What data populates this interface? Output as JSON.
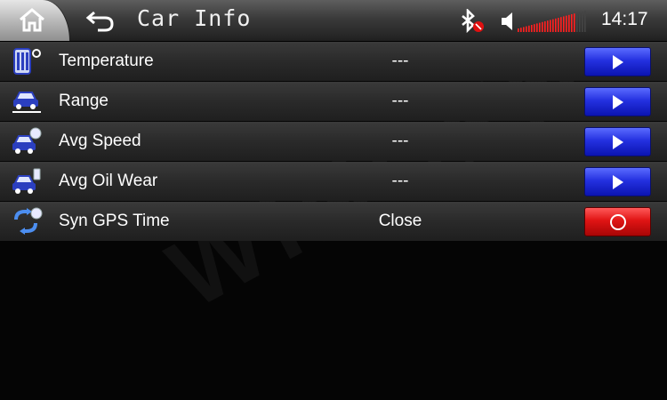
{
  "header": {
    "title": "Car Info",
    "clock": "14:17"
  },
  "icons": {
    "home": "home-icon",
    "back": "back-arrow-icon",
    "bluetooth": "bluetooth-disconnected-icon",
    "volume": "speaker-icon"
  },
  "volume_level": 0.85,
  "rows": [
    {
      "label": "Temperature",
      "value": "---",
      "icon": "thermometer-icon",
      "action": "arrow"
    },
    {
      "label": "Range",
      "value": "---",
      "icon": "car-range-icon",
      "action": "arrow"
    },
    {
      "label": "Avg Speed",
      "value": "---",
      "icon": "car-speed-icon",
      "action": "arrow"
    },
    {
      "label": "Avg Oil Wear",
      "value": "---",
      "icon": "car-fuel-icon",
      "action": "arrow"
    },
    {
      "label": "Syn GPS Time",
      "value": "Close",
      "icon": "sync-gps-icon",
      "action": "toggle"
    }
  ],
  "watermark": "WINCEN",
  "colors": {
    "arrow_button": "#2431e0",
    "toggle_button": "#e01414",
    "volume_bar": "#ff2020"
  }
}
